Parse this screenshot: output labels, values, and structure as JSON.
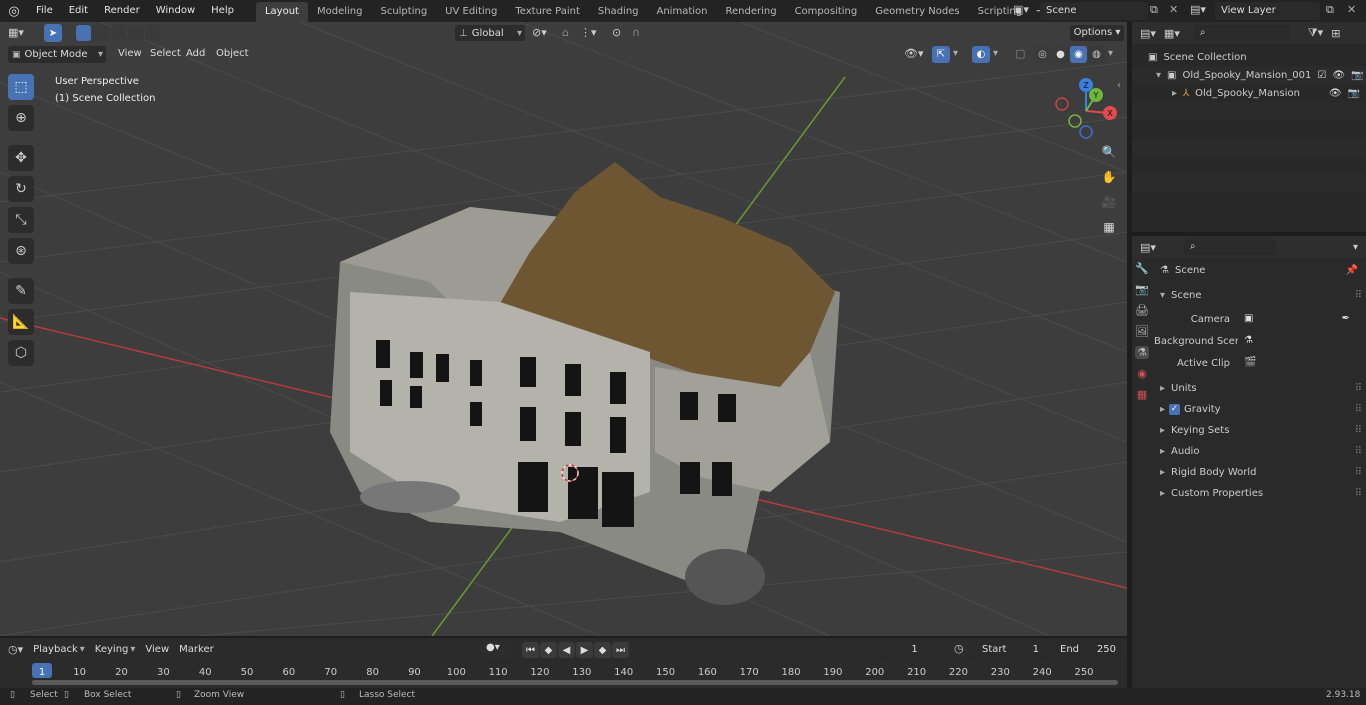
{
  "menu": {
    "items": [
      "File",
      "Edit",
      "Render",
      "Window",
      "Help"
    ]
  },
  "workspaces": {
    "tabs": [
      "Layout",
      "Modeling",
      "Sculpting",
      "UV Editing",
      "Texture Paint",
      "Shading",
      "Animation",
      "Rendering",
      "Compositing",
      "Geometry Nodes",
      "Scripting"
    ],
    "active": "Layout"
  },
  "scene_selector": {
    "value": "Scene"
  },
  "view_layer_selector": {
    "value": "View Layer"
  },
  "viewport_header": {
    "mode": "Object Mode",
    "menus": [
      "View",
      "Select",
      "Add",
      "Object"
    ],
    "transform_orientation": "Global",
    "options_label": "Options"
  },
  "viewport": {
    "perspective_label": "User Perspective",
    "collection_label": "(1) Scene Collection"
  },
  "gizmo": {
    "x": "X",
    "y": "Y",
    "z": "Z"
  },
  "outliner": {
    "root": "Scene Collection",
    "items": [
      {
        "label": "Old_Spooky_Mansion_001"
      },
      {
        "label": "Old_Spooky_Mansion"
      }
    ]
  },
  "properties": {
    "header": "Scene",
    "panel_title": "Scene",
    "fields": [
      {
        "label": "Camera"
      },
      {
        "label": "Background Scene"
      },
      {
        "label": "Active Clip"
      }
    ],
    "sections": [
      "Units",
      "Gravity",
      "Keying Sets",
      "Audio",
      "Rigid Body World",
      "Custom Properties"
    ]
  },
  "timeline": {
    "menus": [
      "Playback",
      "Keying",
      "View",
      "Marker"
    ],
    "current_frame": "1",
    "start_label": "Start",
    "start_value": "1",
    "end_label": "End",
    "end_value": "250",
    "ruler": [
      "1",
      "10",
      "20",
      "30",
      "40",
      "50",
      "60",
      "70",
      "80",
      "90",
      "100",
      "110",
      "120",
      "130",
      "140",
      "150",
      "160",
      "170",
      "180",
      "190",
      "200",
      "210",
      "220",
      "230",
      "240",
      "250"
    ]
  },
  "status_bar": {
    "items": [
      "Select",
      "Box Select",
      "Zoom View",
      "Lasso Select"
    ],
    "version": "2.93.18"
  },
  "colors": {
    "accent": "#4772b3",
    "x_axis": "#b43c3c",
    "y_axis": "#6c9a2a",
    "gizmo_x": "#e14b4b",
    "gizmo_y": "#6bb83a",
    "gizmo_z": "#3b7fe0"
  }
}
